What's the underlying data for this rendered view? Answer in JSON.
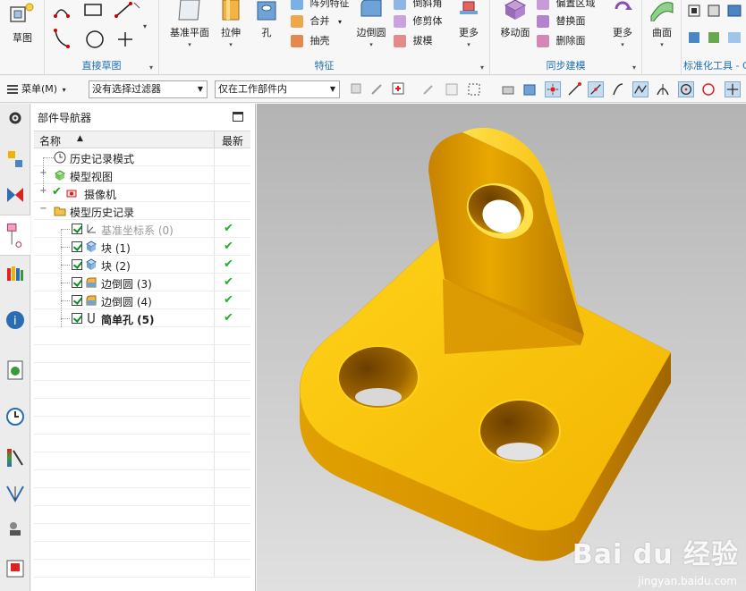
{
  "ribbon": {
    "groups": {
      "sketch": {
        "label": "草图"
      },
      "direct_sketch": {
        "label": "直接草图"
      },
      "feature": {
        "label": "特征",
        "datum_plane": "基准平面",
        "extrude": "拉伸",
        "hole": "孔",
        "pattern_feature": "阵列特征",
        "unite": "合并",
        "shell": "抽壳",
        "edge_blend": "边倒圆",
        "chamfer": "倒斜角",
        "trim_body": "修剪体",
        "draft": "拔模",
        "more": "更多"
      },
      "sync_modeling": {
        "label": "同步建模",
        "move_face": "移动面",
        "offset_region": "偏置区域",
        "replace_face": "替换面",
        "delete_face": "删除面",
        "more": "更多"
      },
      "surface": {
        "label": "曲面"
      },
      "standard_tools": {
        "label": "标准化工具 - G"
      }
    }
  },
  "toolbar2": {
    "menu_label": "菜单(M)",
    "filter_value": "没有选择过滤器",
    "scope_value": "仅在工作部件内"
  },
  "navigator": {
    "title": "部件导航器",
    "col_name": "名称",
    "col_latest": "最新",
    "rows": [
      {
        "label": "历史记录模式",
        "icon": "clock-icon",
        "latest": ""
      },
      {
        "label": "模型视图",
        "icon": "model-views-icon",
        "latest": ""
      },
      {
        "label": "摄像机",
        "icon": "camera-icon",
        "latest": ""
      },
      {
        "label": "模型历史记录",
        "icon": "folder-open-icon",
        "latest": ""
      },
      {
        "label": "基准坐标系 (0)",
        "icon": "datum-csys-icon",
        "latest": "✔"
      },
      {
        "label": "块 (1)",
        "icon": "block-icon",
        "latest": "✔"
      },
      {
        "label": "块 (2)",
        "icon": "block-icon",
        "latest": "✔"
      },
      {
        "label": "边倒圆 (3)",
        "icon": "edge-blend-icon",
        "latest": "✔"
      },
      {
        "label": "边倒圆 (4)",
        "icon": "edge-blend-icon",
        "latest": "✔"
      },
      {
        "label": "简单孔 (5)",
        "icon": "simple-hole-icon",
        "latest": "✔"
      }
    ]
  },
  "watermark": {
    "brand": "Bai du 经验",
    "url": "jingyan.baidu.com"
  },
  "colors": {
    "part_yellow": "#f5b800",
    "part_shadow": "#b87a00",
    "accent": "#1c6fb3",
    "check_green": "#22b020"
  }
}
